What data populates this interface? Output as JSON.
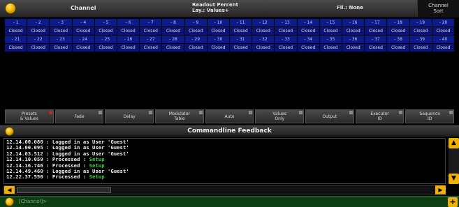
{
  "titlebar": {
    "channel": "Channel",
    "readout_line1": "Readout Percent",
    "readout_line2": "Lay.: Values+",
    "filter": "Fil.: None",
    "sort_line1": "Channel",
    "sort_line2": "Sort"
  },
  "grid": {
    "rows": [
      [
        "- 1",
        "- 2",
        "- 3",
        "- 4",
        "- 5",
        "- 6",
        "- 7",
        "- 8",
        "- 9",
        "- 10",
        "- 11",
        "- 12",
        "- 13",
        "- 14",
        "- 15",
        "- 16",
        "- 17",
        "- 18",
        "- 19",
        "- 20"
      ],
      [
        "Closed",
        "Closed",
        "Closed",
        "Closed",
        "Closed",
        "Closed",
        "Closed",
        "Closed",
        "Closed",
        "Closed",
        "Closed",
        "Closed",
        "Closed",
        "Closed",
        "Closed",
        "Closed",
        "Closed",
        "Closed",
        "Closed",
        "Closed"
      ],
      [
        "- 21",
        "- 22",
        "- 23",
        "- 24",
        "- 25",
        "- 26",
        "- 27",
        "- 28",
        "- 29",
        "- 30",
        "- 31",
        "- 32",
        "- 33",
        "- 34",
        "- 35",
        "- 36",
        "- 37",
        "- 38",
        "- 39",
        "- 40"
      ],
      [
        "Closed",
        "Closed",
        "Closed",
        "Closed",
        "Closed",
        "Closed",
        "Closed",
        "Closed",
        "Closed",
        "Closed",
        "Closed",
        "Closed",
        "Closed",
        "Closed",
        "Closed",
        "Closed",
        "Closed",
        "Closed",
        "Closed",
        "Closed"
      ]
    ]
  },
  "functions": [
    {
      "line1": "Presets",
      "line2": "& Values",
      "marker": "red"
    },
    {
      "line1": "Fade",
      "line2": "",
      "marker": "gray"
    },
    {
      "line1": "Delay",
      "line2": "",
      "marker": "gray"
    },
    {
      "line1": "Modulator",
      "line2": "Table",
      "marker": "gray"
    },
    {
      "line1": "Auto",
      "line2": "",
      "marker": "gray"
    },
    {
      "line1": "Values",
      "line2": "Only",
      "marker": "gray"
    },
    {
      "line1": "Output",
      "line2": "",
      "marker": "gray"
    },
    {
      "line1": "Executor",
      "line2": "ID",
      "marker": "gray"
    },
    {
      "line1": "Sequence",
      "line2": "ID",
      "marker": "gray"
    }
  ],
  "feedback": {
    "title": "Commandline Feedback",
    "lines": [
      {
        "text": "12.14.00.080 : Logged in as User 'Guest'",
        "hl": ""
      },
      {
        "text": "12.14.00.095 : Logged in as User 'Guest'",
        "hl": ""
      },
      {
        "text": "12.14.03.512 : Logged in as User 'Guest'",
        "hl": ""
      },
      {
        "text": "12.14.10.059 : Processed : ",
        "hl": "Setup"
      },
      {
        "text": "12.14.16.746 : Processed : ",
        "hl": "Setup"
      },
      {
        "text": "12.14.49.460 : Logged in as User 'Guest'",
        "hl": ""
      },
      {
        "text": "12.22.37.550 : Processed : ",
        "hl": "Setup"
      }
    ]
  },
  "cmdline": {
    "prompt": "[Channel]>"
  },
  "icons": {
    "scroll_up": "▲",
    "scroll_down": "▼",
    "scroll_left": "◀",
    "scroll_right": "▶",
    "add": "+"
  },
  "colors": {
    "grid_cell": "#0c1a8a",
    "accent": "#f0b000",
    "highlight": "#3fd13f",
    "cmd_bg": "#0e3f12"
  }
}
